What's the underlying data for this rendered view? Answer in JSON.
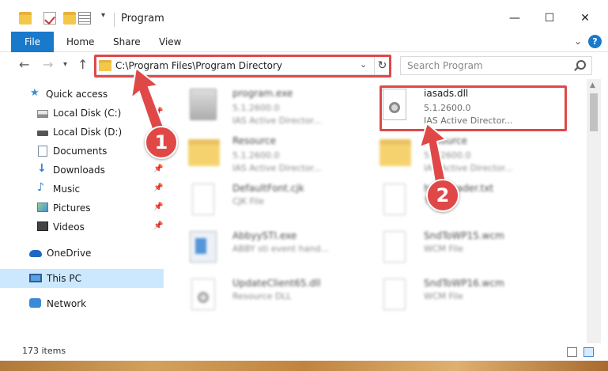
{
  "window": {
    "title": "Program",
    "minimize": "—",
    "maximize": "☐",
    "close": "✕"
  },
  "ribbon": {
    "file": "File",
    "home": "Home",
    "share": "Share",
    "view": "View",
    "help": "?"
  },
  "address": {
    "path": "C:\\Program Files\\Program Directory",
    "search_placeholder": "Search Program"
  },
  "sidebar": {
    "items": [
      {
        "label": "Quick access",
        "icon": "star-icon"
      },
      {
        "label": "Local Disk (C:)",
        "icon": "disk-icon"
      },
      {
        "label": "Local Disk (D:)",
        "icon": "disk-icon"
      },
      {
        "label": "Documents",
        "icon": "documents-icon"
      },
      {
        "label": "Downloads",
        "icon": "downloads-icon"
      },
      {
        "label": "Music",
        "icon": "music-icon"
      },
      {
        "label": "Pictures",
        "icon": "pictures-icon"
      },
      {
        "label": "Videos",
        "icon": "videos-icon"
      },
      {
        "label": "OneDrive",
        "icon": "cloud-icon"
      },
      {
        "label": "This PC",
        "icon": "pc-icon"
      },
      {
        "label": "Network",
        "icon": "network-icon"
      }
    ]
  },
  "files": [
    {
      "name": "program.exe",
      "line1": "5.1.2600.0",
      "line2": "IAS Active Director..."
    },
    {
      "name": "iasads.dll",
      "line1": "5.1.2600.0",
      "line2": "IAS Active Director..."
    },
    {
      "name": "Resource",
      "line1": "5.1.2600.0",
      "line2": "IAS Active Director..."
    },
    {
      "name": "Resource",
      "line1": "5.1.2600.0",
      "line2": "IAS Active Director..."
    },
    {
      "name": "DefaultFont.cjk",
      "line1": "CJK File",
      "line2": ""
    },
    {
      "name": "h...eReader.txt",
      "line1": "T...",
      "line2": ""
    },
    {
      "name": "AbbyySTI.exe",
      "line1": "ABBY sti event hand...",
      "line2": ""
    },
    {
      "name": "SndToWP15.wcm",
      "line1": "WCM File",
      "line2": ""
    },
    {
      "name": "UpdateClient65.dll",
      "line1": "Resource DLL",
      "line2": ""
    },
    {
      "name": "SndToWP16.wcm",
      "line1": "WCM File",
      "line2": ""
    }
  ],
  "status": {
    "items_count": "173 items"
  },
  "callouts": {
    "one": "1",
    "two": "2"
  },
  "colors": {
    "accent": "#1979ca",
    "highlight": "#e04848",
    "selection": "#cce8ff"
  }
}
